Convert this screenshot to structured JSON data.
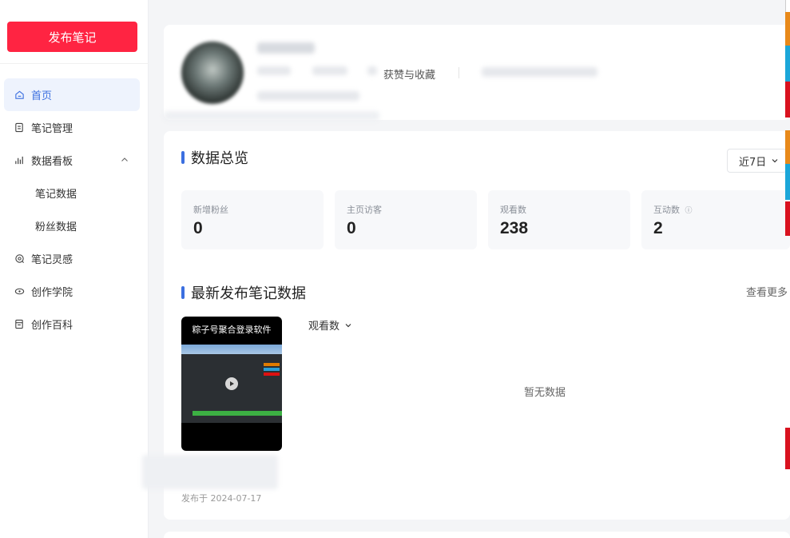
{
  "sidebar": {
    "publish_label": "发布笔记",
    "items": [
      {
        "label": "首页",
        "icon": "home-icon",
        "active": true
      },
      {
        "label": "笔记管理",
        "icon": "note-icon"
      },
      {
        "label": "数据看板",
        "icon": "chart-icon",
        "expanded": true
      },
      {
        "label": "笔记数据",
        "sub": true
      },
      {
        "label": "粉丝数据",
        "sub": true
      },
      {
        "label": "笔记灵感",
        "icon": "inspiration-icon"
      },
      {
        "label": "创作学院",
        "icon": "academy-icon"
      },
      {
        "label": "创作百科",
        "icon": "wiki-icon"
      }
    ]
  },
  "profile": {
    "likes_label": "获赞与收藏"
  },
  "overview": {
    "title": "数据总览",
    "range": "近7日",
    "stats": [
      {
        "label": "新增粉丝",
        "value": "0"
      },
      {
        "label": "主页访客",
        "value": "0"
      },
      {
        "label": "观看数",
        "value": "238"
      },
      {
        "label": "互动数",
        "value": "2",
        "info": "ⓘ"
      }
    ]
  },
  "latest": {
    "title": "最新发布笔记数据",
    "view_more": "查看更多",
    "metric": "观看数",
    "empty": "暂无数据",
    "note": {
      "thumb_title": "粽子号聚合登录软件",
      "published": "发布于 2024-07-17"
    }
  },
  "colors": {
    "brand_red": "#ff2442",
    "accent_blue": "#3b6fe0"
  }
}
